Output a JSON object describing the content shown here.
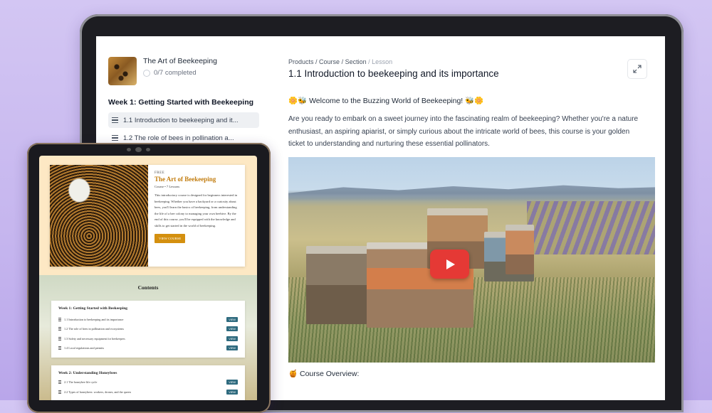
{
  "laptop": {
    "sidebar": {
      "course_title": "The Art of Beekeeping",
      "progress": "0/7 completed",
      "week_title": "Week 1: Getting Started with Beekeeping",
      "lessons": [
        {
          "label": "1.1 Introduction to beekeeping and it..."
        },
        {
          "label": "1.2 The role of bees in pollination a..."
        }
      ]
    },
    "main": {
      "breadcrumb": {
        "products": "Products",
        "sep": " / ",
        "course": "Course",
        "section": "Section",
        "lesson": "Lesson"
      },
      "title": "1.1 Introduction to beekeeping and its importance",
      "welcome": "🌼🐝 Welcome to the Buzzing World of Beekeeping! 🐝🌼",
      "paragraph": "Are you ready to embark on a sweet journey into the fascinating realm of beekeeping? Whether you're a nature enthusiast, an aspiring apiarist, or simply curious about the intricate world of bees, this course is your golden ticket to understanding and nurturing these essential pollinators.",
      "overview": "🍯 Course Overview:",
      "icons": {
        "expand": "expand-icon",
        "play": "play-icon"
      }
    }
  },
  "tablet": {
    "hero": {
      "tag": "FREE",
      "title": "The Art of Beekeeping",
      "meta": "Course • 7 Lessons",
      "description": "This introductory course is designed for beginners interested in beekeeping. Whether you have a backyard or a curiosity about bees, you'll learn the basics of beekeeping, from understanding the life of a bee colony to managing your own beehive. By the end of this course, you'll be equipped with the knowledge and skills to get started in the world of beekeeping.",
      "button": "VIEW COURSE"
    },
    "contents_title": "Contents",
    "weeks": [
      {
        "title": "Week 1: Getting Started with Beekeeping",
        "lessons": [
          {
            "label": "1.1 Introduction to beekeeping and its importance",
            "action": "VIEW"
          },
          {
            "label": "1.2 The role of bees in pollination and ecosystems",
            "action": "VIEW"
          },
          {
            "label": "1.3 Safety and necessary equipment for beekeepers",
            "action": "VIEW"
          },
          {
            "label": "1.4 Local regulations and permits",
            "action": "VIEW"
          }
        ]
      },
      {
        "title": "Week 2: Understanding Honeybees",
        "lessons": [
          {
            "label": "2.1 The honeybee life cycle",
            "action": "VIEW"
          },
          {
            "label": "2.2 Types of honeybees: workers, drones, and the queen",
            "action": "VIEW"
          }
        ]
      }
    ]
  },
  "colors": {
    "background": "#c9baf0",
    "accent_orange": "#d4900f",
    "view_teal": "#2f6b7f",
    "play_red": "#e53935"
  }
}
